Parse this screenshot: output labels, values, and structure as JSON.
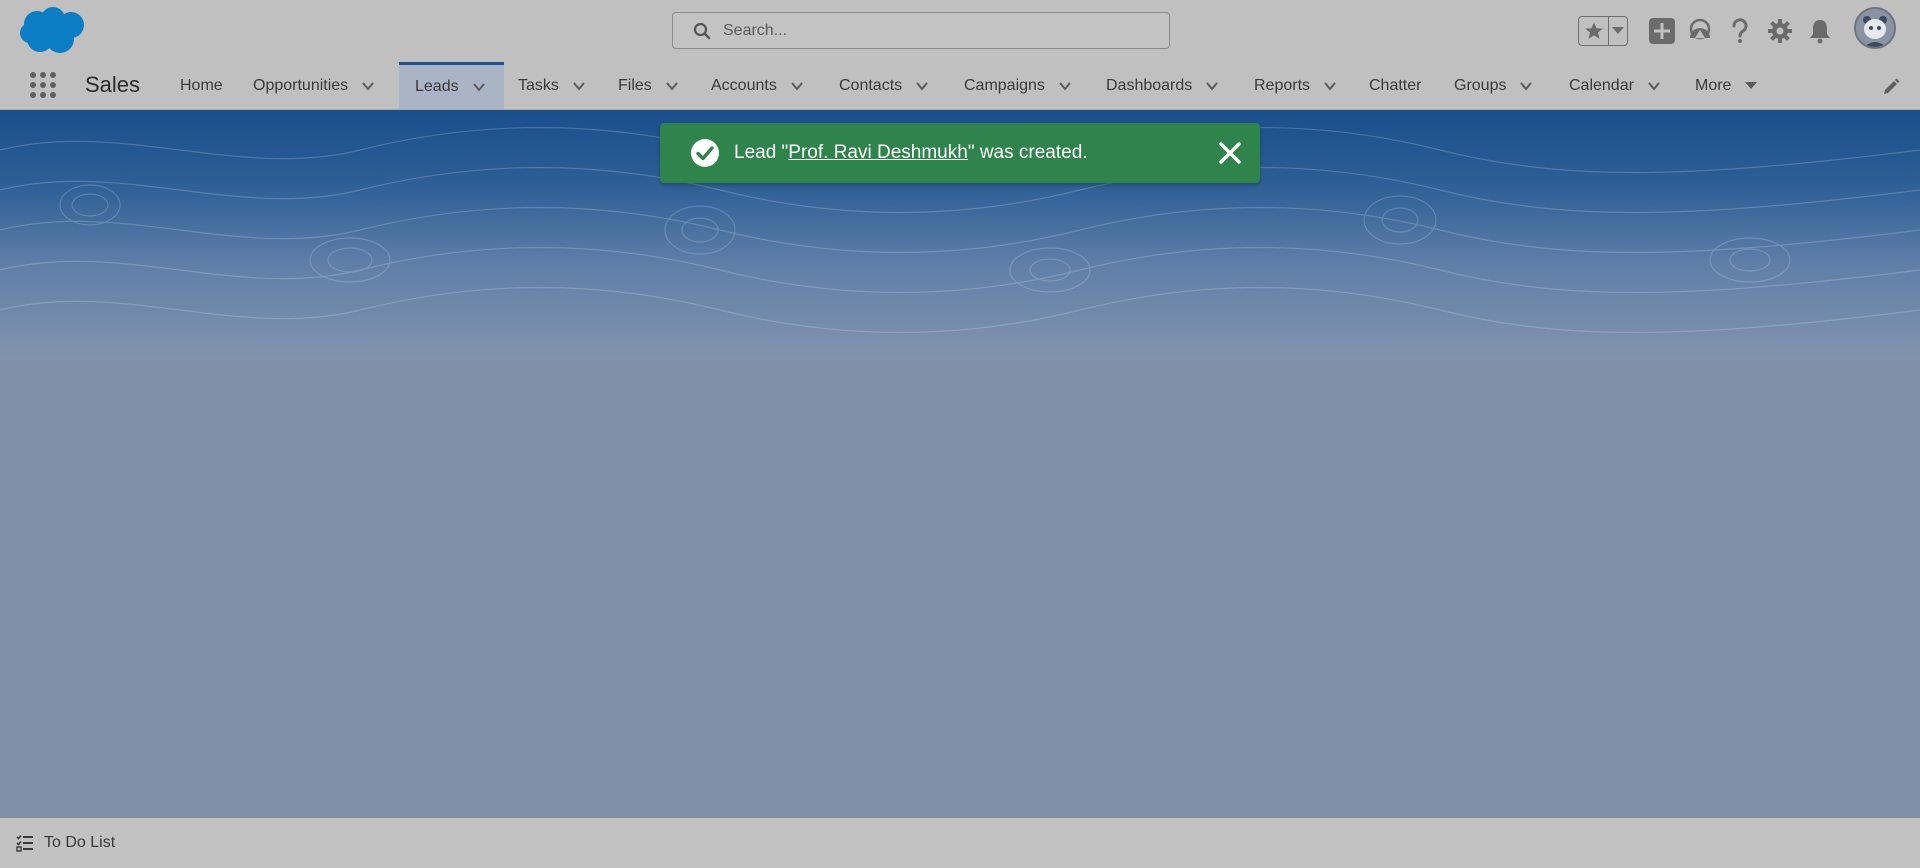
{
  "header": {
    "search_placeholder": "Search...",
    "icons": [
      "salesforce-cloud-logo",
      "search-icon",
      "star-icon",
      "chevron-down-icon",
      "add-icon",
      "trailhead-icon",
      "help-icon",
      "gear-icon",
      "bell-icon",
      "avatar"
    ]
  },
  "nav": {
    "app_name": "Sales",
    "items": [
      {
        "label": "Home"
      },
      {
        "label": "Opportunities"
      },
      {
        "label": "Leads"
      },
      {
        "label": "Tasks"
      },
      {
        "label": "Files"
      },
      {
        "label": "Accounts"
      },
      {
        "label": "Contacts"
      },
      {
        "label": "Campaigns"
      },
      {
        "label": "Dashboards"
      },
      {
        "label": "Reports"
      },
      {
        "label": "Chatter"
      },
      {
        "label": "Groups"
      },
      {
        "label": "Calendar"
      },
      {
        "label": "More"
      }
    ],
    "active": "Leads"
  },
  "toast": {
    "prefix": "Lead \"",
    "link": "Prof. Ravi Deshmukh",
    "suffix": "\" was created.",
    "color": "#2e844a"
  },
  "footer": {
    "todo_label": "To Do List"
  },
  "colors": {
    "brand_blue": "#0b7dc4",
    "active_tab_border": "#1b5297"
  }
}
